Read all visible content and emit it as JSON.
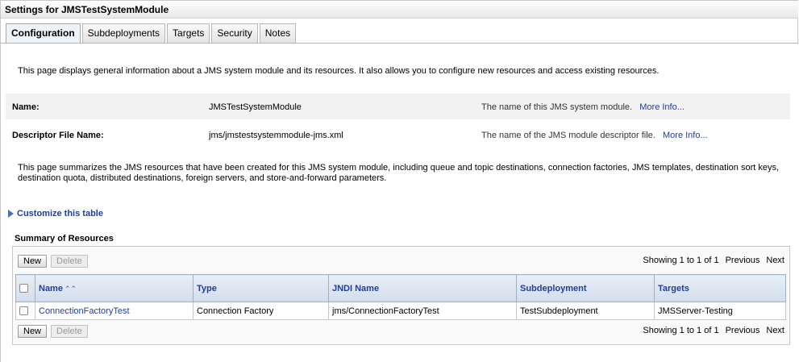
{
  "window": {
    "title": "Settings for JMSTestSystemModule"
  },
  "tabs": [
    {
      "label": "Configuration",
      "active": true
    },
    {
      "label": "Subdeployments"
    },
    {
      "label": "Targets"
    },
    {
      "label": "Security"
    },
    {
      "label": "Notes"
    }
  ],
  "intro_text": "This page displays general information about a JMS system module and its resources. It also allows you to configure new resources and access existing resources.",
  "properties": {
    "name": {
      "label": "Name:",
      "value": "JMSTestSystemModule",
      "help": "The name of this JMS system module.",
      "more_info": "More Info..."
    },
    "descriptor": {
      "label": "Descriptor File Name:",
      "value": "jms/jmstestsystemmodule-jms.xml",
      "help": "The name of the JMS module descriptor file.",
      "more_info": "More Info..."
    }
  },
  "summary_text": "This page summarizes the JMS resources that have been created for this JMS system module, including queue and topic destinations, connection factories, JMS templates, destination sort keys, destination quota, distributed destinations, foreign servers, and store-and-forward parameters.",
  "customize_link": "Customize this table",
  "resources": {
    "title": "Summary of Resources",
    "new_label": "New",
    "delete_label": "Delete",
    "paging": {
      "showing": "Showing 1 to 1 of 1",
      "previous": "Previous",
      "next": "Next"
    },
    "columns": [
      "Name",
      "Type",
      "JNDI Name",
      "Subdeployment",
      "Targets"
    ],
    "sort_icon": "ascending-sort-icon",
    "rows": [
      {
        "name": "ConnectionFactoryTest",
        "type": "Connection Factory",
        "jndi": "jms/ConnectionFactoryTest",
        "subdeployment": "TestSubdeployment",
        "targets": "JMSServer-Testing"
      }
    ]
  },
  "colors": {
    "link": "#1f3f97",
    "header_bg": "#d3deec",
    "accent": "#4b6fb5"
  }
}
